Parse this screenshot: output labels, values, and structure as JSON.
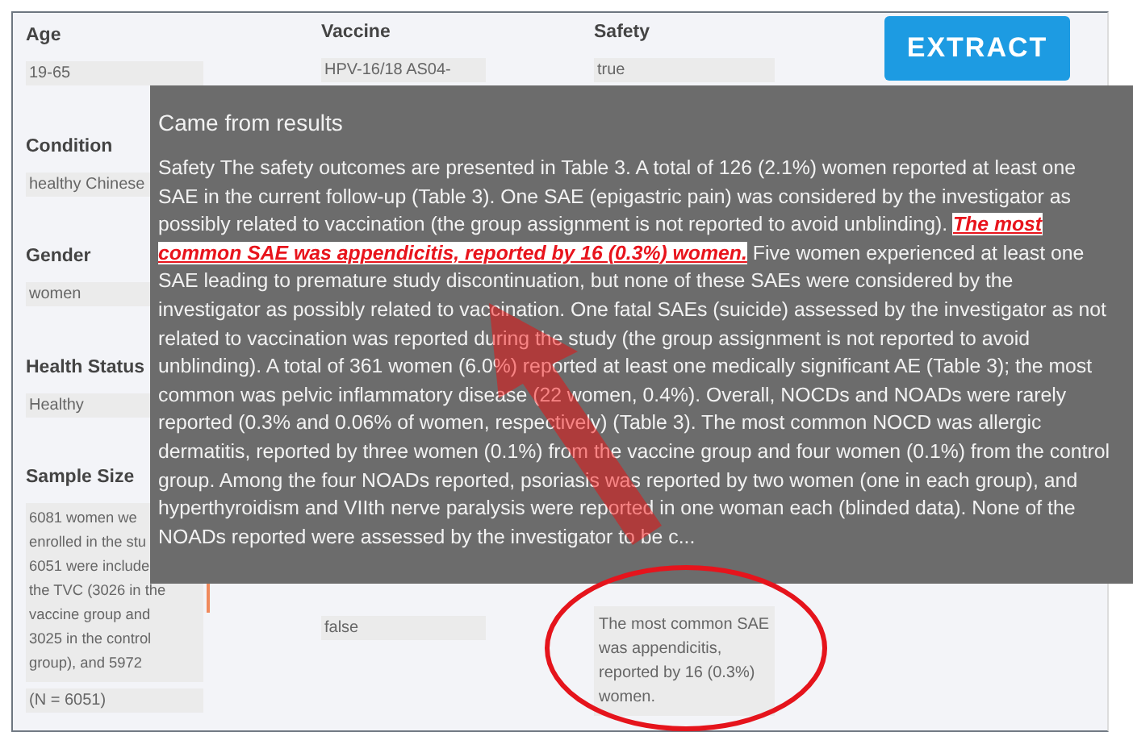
{
  "columns": [
    {
      "fields": [
        {
          "label": "Age",
          "value": "19-65"
        },
        {
          "label": "Condition",
          "value": "healthy Chinese"
        },
        {
          "label": "Gender",
          "value": "women"
        },
        {
          "label": "Health Status",
          "value": "Healthy"
        },
        {
          "label": "Sample Size",
          "lines": [
            "6081 women we",
            "enrolled in the stu",
            "6051 were include",
            "the TVC (3026 in the",
            "vaccine group and",
            "3025 in the control",
            "group), and 5972"
          ]
        },
        {
          "value": "(N = 6051)"
        }
      ]
    },
    {
      "fields": [
        {
          "label": "Vaccine",
          "value": "HPV-16/18 AS04-"
        },
        {
          "value": "false"
        }
      ]
    },
    {
      "fields": [
        {
          "label": "Safety",
          "value": "true"
        },
        {
          "value": "The most common SAE was appendicitis, reported by 16 (0.3%) women."
        }
      ]
    }
  ],
  "buttons": [
    "EXTRACT"
  ],
  "popup": {
    "title": "Came from results",
    "text": "Safety The safety outcomes are presented in Table 3. A total of 126 (2.1%) women reported at least one SAE in the current follow-up (Table 3). One SAE (epigastric pain) was considered by the investigator as possibly related to vaccination (the group assignment is not reported to avoid unblinding). *The most common SAE was appendicitis, reported by 16 (0.3%) women.* Five women experienced at least one SAE leading to premature study discontinuation, but none of these SAEs were considered by the investigator as possibly related to vaccination. One fatal SAEs (suicide) assessed by the investigator as not related to vaccination was reported during the study (the group assignment is not reported to avoid unblinding). A total of 361 women (6.0%) reported at least one medically significant AE (Table 3); the most common was pelvic inflammatory disease (22 women, 0.4%). Overall, NOCDs and NOADs were rarely reported (0.3% and 0.06% of women, respectively) (Table 3). The most common NOCD was allergic dermatitis, reported by three women (0.1%) from the vaccine group and four women (0.1%) from the control group. Among the four NOADs reported, psoriasis was reported by two women (one in each group), and hyperthyroidism and VIIth nerve paralysis were reported in one woman each (blinded data). None of the NOADs reported were assessed by the investigator to be c..."
  }
}
